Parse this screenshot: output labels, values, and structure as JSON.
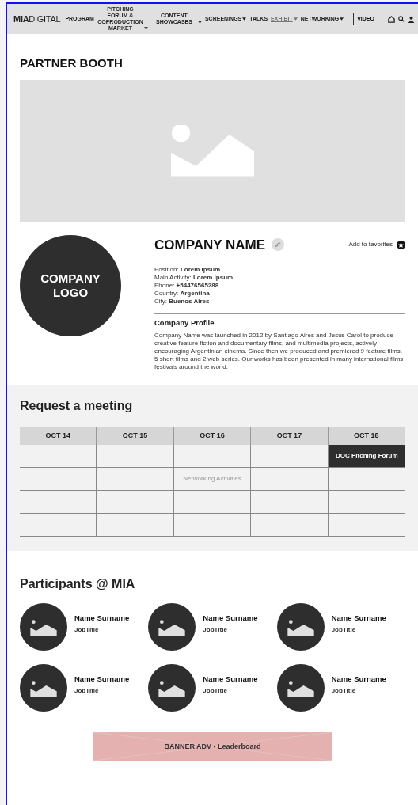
{
  "nav": {
    "logo_bold": "MIA",
    "logo_light": "DIGITAL",
    "items": [
      {
        "label": "PROGRAM",
        "dropdown": false,
        "disabled": false
      },
      {
        "label": "PITCHING FORUM & COPRODUCTION MARKET",
        "dropdown": true,
        "disabled": false
      },
      {
        "label": "CONTENT SHOWCASES",
        "dropdown": true,
        "disabled": false
      },
      {
        "label": "SCREENINGS",
        "dropdown": true,
        "disabled": false
      },
      {
        "label": "TALKS",
        "dropdown": false,
        "disabled": false
      },
      {
        "label": "EXHIBIT",
        "dropdown": true,
        "disabled": true
      },
      {
        "label": "NETWORKING",
        "dropdown": true,
        "disabled": false
      }
    ],
    "video_button": "VIDEO"
  },
  "page_title": "PARTNER BOOTH",
  "company": {
    "logo_text": "COMPANY LOGO",
    "name": "COMPANY NAME",
    "favorite_label": "Add to favorites",
    "details": [
      "Position: **Lorem Ipsum**",
      "Main Activity: **Lorem Ipsum**",
      "Phone: **+54476565288**",
      "Country: **Argentina**",
      "City: **Buenos Aires**"
    ],
    "profile_title": "Company Profile",
    "profile_text": "Company Name was launched in 2012 by Santiago Aires and Jesus Carol to produce creative feature fiction and documentary films, and multimedia projects, actively encouraging Argentinian cinema. Since then we produced and premiered 9 feature films, 5 short films and 2 web series. Our works has been presented in many international films festivals around the world."
  },
  "meeting": {
    "title": "Request a meeting",
    "columns": [
      "OCT 14",
      "OCT 15",
      "OCT 16",
      "OCT 17",
      "OCT 18"
    ],
    "rows": [
      [
        "",
        "",
        "",
        "",
        {
          "text": "DOC Pitching Forum",
          "kind": "event"
        }
      ],
      [
        "",
        "",
        {
          "text": "Networking Activities",
          "kind": "faint"
        },
        "",
        ""
      ],
      [
        "",
        "",
        "",
        "",
        ""
      ],
      [
        "",
        "",
        "",
        "",
        ""
      ]
    ]
  },
  "participants": {
    "title": "Participants @ MIA",
    "people": [
      {
        "name": "Name Surname",
        "job": "JobTitle"
      },
      {
        "name": "Name Surname",
        "job": "JobTitle"
      },
      {
        "name": "Name Surname",
        "job": "JobTitle"
      },
      {
        "name": "Name Surname",
        "job": "JobTitle"
      },
      {
        "name": "Name Surname",
        "job": "JobTitle"
      },
      {
        "name": "Name Surname",
        "job": "JobTitle"
      }
    ]
  },
  "banner": "BANNER ADV - Leaderboard"
}
